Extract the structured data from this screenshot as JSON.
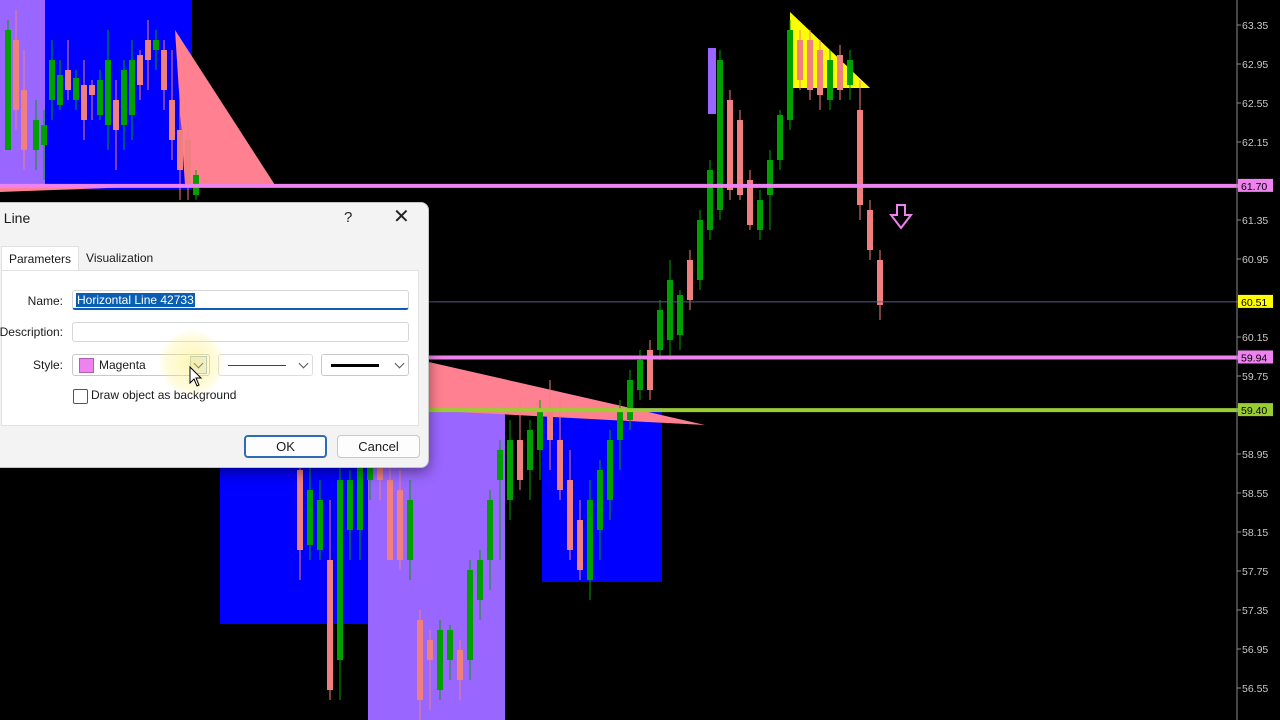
{
  "chart": {
    "price_axis": {
      "ticks": [
        "63.35",
        "62.95",
        "62.55",
        "62.15",
        "61.35",
        "60.95",
        "60.15",
        "59.75",
        "58.95",
        "58.55",
        "58.15",
        "57.75",
        "57.35",
        "56.95",
        "56.55"
      ],
      "labels": [
        {
          "text": "61.70",
          "color": "#ee82ee"
        },
        {
          "text": "60.51",
          "color": "#ffff00"
        },
        {
          "text": "59.94",
          "color": "#ee82ee"
        },
        {
          "text": "59.40",
          "color": "#9acd32"
        }
      ]
    },
    "colors": {
      "background": "#000000",
      "bull_candle": "#00a000",
      "bear_candle": "#f08080",
      "blue_zone": "#0000ff",
      "purple_zone": "#9966ff",
      "pink_fill": "#ff8090",
      "yellow_fill": "#ffff00",
      "magenta_line": "#ee82ee",
      "green_line": "#9acd32"
    },
    "arrow_icon": "down-arrow-icon"
  },
  "dialog": {
    "title": "al Line",
    "help": "?",
    "close_icon": "close-icon",
    "tabs": [
      "Parameters",
      "Visualization"
    ],
    "name_label": "Name:",
    "name_value": "Horizontal Line 42733",
    "description_label": "Description:",
    "description_value": "",
    "style_label": "Style:",
    "color_value": "Magenta",
    "draw_background_label": "Draw object as background",
    "ok": "OK",
    "cancel": "Cancel"
  }
}
